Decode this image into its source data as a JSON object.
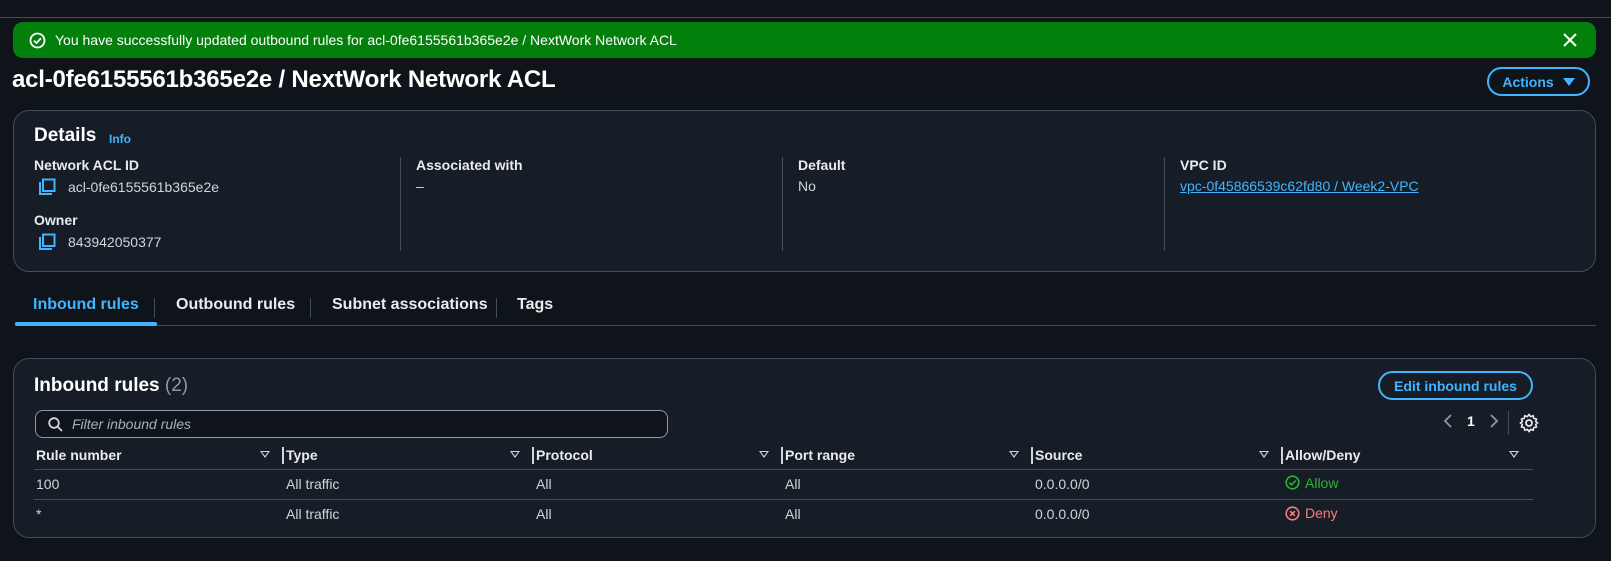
{
  "flash": {
    "message": "You have successfully updated outbound rules for acl-0fe6155561b365e2e / NextWork Network ACL",
    "icon": "success-circle-icon",
    "color": "#037f0c"
  },
  "page": {
    "title": "acl-0fe6155561b365e2e / NextWork Network ACL",
    "actions_label": "Actions"
  },
  "details": {
    "title": "Details",
    "info_label": "Info",
    "network_acl_id_label": "Network ACL ID",
    "network_acl_id": "acl-0fe6155561b365e2e",
    "owner_label": "Owner",
    "owner": "843942050377",
    "associated_label": "Associated with",
    "associated": "–",
    "default_label": "Default",
    "default": "No",
    "vpc_label": "VPC ID",
    "vpc": "vpc-0f45866539c62fd80 / Week2-VPC"
  },
  "tabs": [
    {
      "label": "Inbound rules",
      "active": true
    },
    {
      "label": "Outbound rules",
      "active": false
    },
    {
      "label": "Subnet associations",
      "active": false
    },
    {
      "label": "Tags",
      "active": false
    }
  ],
  "rules": {
    "title": "Inbound rules",
    "count": "(2)",
    "edit_label": "Edit inbound rules",
    "search_placeholder": "Filter inbound rules",
    "page": "1",
    "columns": [
      "Rule number",
      "Type",
      "Protocol",
      "Port range",
      "Source",
      "Allow/Deny"
    ],
    "rows": [
      {
        "rule": "100",
        "type": "All traffic",
        "protocol": "All",
        "port": "All",
        "source": "0.0.0.0/0",
        "action": "Allow"
      },
      {
        "rule": "*",
        "type": "All traffic",
        "protocol": "All",
        "port": "All",
        "source": "0.0.0.0/0",
        "action": "Deny"
      }
    ]
  },
  "colors": {
    "accent": "#42b4ff",
    "allow": "#2bb534",
    "deny": "#ff7a7a",
    "background": "#0f141a",
    "panel": "#161d26"
  }
}
